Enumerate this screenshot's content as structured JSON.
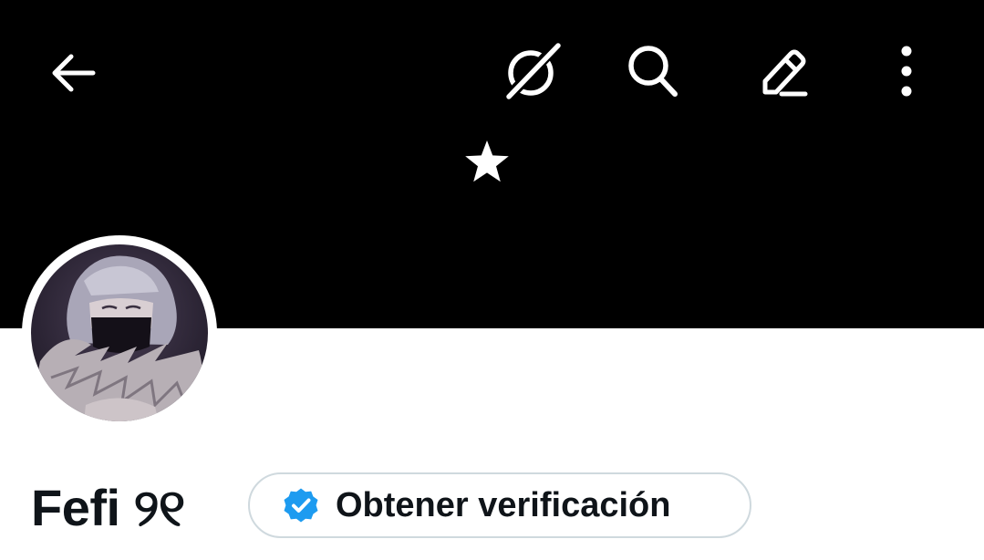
{
  "header": {
    "icons": {
      "back": "arrow-left-icon",
      "grok": "grok-icon",
      "search": "search-icon",
      "edit": "edit-icon",
      "more": "more-vertical-icon"
    },
    "banner_symbol": "★"
  },
  "profile": {
    "display_name": "Fefi ୨୧",
    "avatar_icon": "avatar-image",
    "verify_button_label": "Obtener verificación",
    "verify_icon": "verified-badge-icon"
  },
  "colors": {
    "banner": "#000000",
    "text_primary": "#0f1419",
    "verified_blue": "#1d9bf0",
    "border": "#cfd9de"
  }
}
